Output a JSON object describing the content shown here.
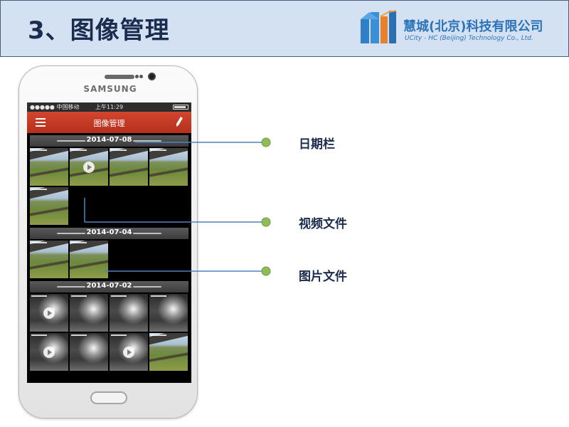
{
  "slide": {
    "title": "3、图像管理",
    "company_cn": "慧城(北京)科技有限公司",
    "company_en": "UCity - HC (Beijing) Technology Co., Ltd."
  },
  "phone": {
    "brand": "SAMSUNG",
    "status": {
      "carrier": "●●●●● 中国移动",
      "time": "上午11:29"
    },
    "appbar": {
      "title": "图像管理",
      "menu_icon": "hamburger-menu-icon",
      "edit_icon": "pencil-icon"
    },
    "groups": [
      {
        "date": "2014-07-08",
        "thumbs": [
          "day",
          "day-video",
          "day",
          "day",
          "day"
        ]
      },
      {
        "date": "2014-07-04",
        "thumbs": [
          "day",
          "day"
        ]
      },
      {
        "date": "2014-07-02",
        "thumbs": [
          "night-video",
          "night",
          "night",
          "night",
          "night-video",
          "night",
          "night-video",
          "day"
        ]
      }
    ]
  },
  "callouts": {
    "date_bar": "日期栏",
    "video_file": "视频文件",
    "image_file": "图片文件"
  },
  "colors": {
    "header_bg": "#d4e1f3",
    "title_color": "#1b2c4e",
    "appbar_red": "#c33a24",
    "callout_line": "#4f81bd",
    "callout_dot": "#8fbc5a"
  }
}
